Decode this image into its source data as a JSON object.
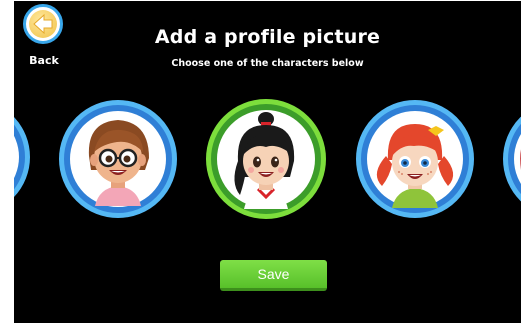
{
  "back": {
    "label": "Back"
  },
  "header": {
    "title": "Add a profile picture",
    "subtitle": "Choose one of the characters below"
  },
  "characters": [
    {
      "id": "edge-left",
      "selected": false,
      "ring_color": "#55b8f4"
    },
    {
      "id": "girl-glasses",
      "selected": false,
      "ring_color": "#55b8f4"
    },
    {
      "id": "girl-ponytail",
      "selected": true,
      "ring_color": "#7dde3c"
    },
    {
      "id": "girl-redhead",
      "selected": false,
      "ring_color": "#55b8f4"
    },
    {
      "id": "edge-right",
      "selected": false,
      "ring_color": "#55b8f4"
    }
  ],
  "save": {
    "label": "Save",
    "color": "#6bd13a"
  }
}
